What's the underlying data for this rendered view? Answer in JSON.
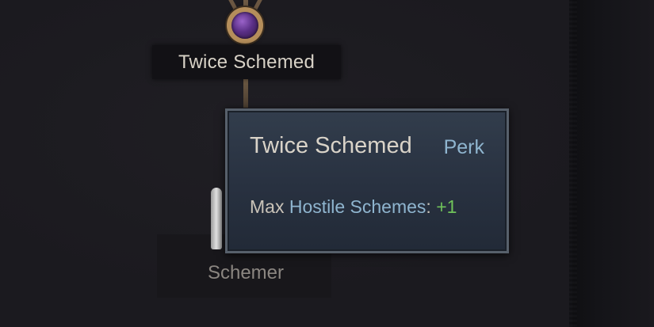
{
  "perk_tree": {
    "perk": {
      "name": "Twice Schemed",
      "icon": "purple-gem-icon",
      "colors": {
        "gem": "#5a2f86",
        "frame": "#b58e5b"
      }
    },
    "next_node": {
      "label": "Schemer",
      "icon": "schemer-figure-icon"
    }
  },
  "tooltip": {
    "title": "Twice Schemed",
    "type": "Perk",
    "effect": {
      "prefix": "Max",
      "link": "Hostile Schemes",
      "colon": ":",
      "value": "+1"
    },
    "colors": {
      "link": "#8fb5cf",
      "positive": "#6fc25a",
      "background": "#283140"
    }
  }
}
